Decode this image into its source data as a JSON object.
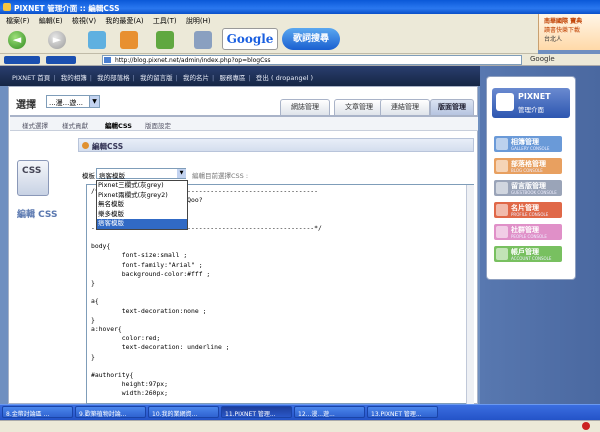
{
  "window": {
    "title": "PIXNET 管理介面 :: 編輯CSS"
  },
  "menu": [
    "檔案(F)",
    "編輯(E)",
    "檢視(V)",
    "我的最愛(A)",
    "工具(T)",
    "說明(H)"
  ],
  "ad": {
    "line1": "南華國際 寶典",
    "line2": "讀書快樂下載",
    "line3": "台北人"
  },
  "toolbar": {
    "search_logo": "Google",
    "search_button": "歌詞搜尋",
    "back": "◄",
    "forward": "►"
  },
  "address": {
    "url": "http://blog.pixnet.net/admin/index.php?op=blogCss",
    "search_label": "Google"
  },
  "sitenav": [
    "PIXNET 首頁",
    "我的相簿",
    "我的部落格",
    "我的留言版",
    "我的名片",
    "服務專區",
    "登出 ( dropangel )"
  ],
  "blog_select": {
    "label": "選擇",
    "value": "...漫...遊..."
  },
  "main_tabs": [
    {
      "label": "網誌管理",
      "active": false
    },
    {
      "label": "文章管理",
      "active": false
    },
    {
      "label": "連結管理",
      "active": false
    },
    {
      "label": "版面管理",
      "active": true
    }
  ],
  "sub_tabs": [
    {
      "label": "樣式選擇",
      "active": false
    },
    {
      "label": "樣式貢獻",
      "active": false
    },
    {
      "label": "編輯CSS",
      "active": true
    },
    {
      "label": "版面設定",
      "active": false
    }
  ],
  "sidebar": {
    "icon_text": "CSS",
    "title": "編輯 CSS"
  },
  "section": {
    "title": "編輯CSS"
  },
  "template": {
    "label": "模板",
    "value": "痞客模版",
    "hint": "編輯目前選擇CSS :"
  },
  "dropdown": [
    "Pixnet三欄式(灰grey)",
    "Pixnet兩欄式(灰grey2)",
    "無名模版",
    "樂多模版",
    "痞客模版"
  ],
  "dropdown_selected": 4,
  "code": "/*---------------------------------------------------------\n   Blog template - 4 - YaQoo?\n   design by PRINCESSWOW\n\n----------------------------------------------------------*/\n\nbody{\n        font-size:small ;\n        font-family:\"Arial\" ;\n        background-color:#fff ;\n}\n\na{\n        text-decoration:none ;\n}\na:hover{\n        color:red;\n        text-decoration: underline ;\n}\n\n#authority{\n        height:97px;\n        width:260px;",
  "console": {
    "logo_name": "PIXNET",
    "logo_sub": "管理介面",
    "items": [
      {
        "label": "相簿管理",
        "sub": "GALLERY CONSOLE",
        "color": "#6a9ad8"
      },
      {
        "label": "部落格管理",
        "sub": "BLOG CONSOLE",
        "color": "#e8a060"
      },
      {
        "label": "留言版管理",
        "sub": "GUESTBOOK CONSOLE",
        "color": "#9aa4b8"
      },
      {
        "label": "名片管理",
        "sub": "PROFILE CONSOLE",
        "color": "#e06848"
      },
      {
        "label": "社群管理",
        "sub": "PEOPLE CONSOLE",
        "color": "#e090c8"
      },
      {
        "label": "帳戶管理",
        "sub": "ACCOUNT CONSOLE",
        "color": "#78c060"
      }
    ]
  },
  "taskbar": [
    {
      "label": "8.金幣討論區 ...",
      "active": false
    },
    {
      "label": "9.歡築植物討論...",
      "active": false
    },
    {
      "label": "10.我的業網資...",
      "active": false
    },
    {
      "label": "11.PIXNET 管理...",
      "active": true
    },
    {
      "label": "12...漫...遊...",
      "active": false
    },
    {
      "label": "13.PIXNET 管理...",
      "active": false
    }
  ]
}
